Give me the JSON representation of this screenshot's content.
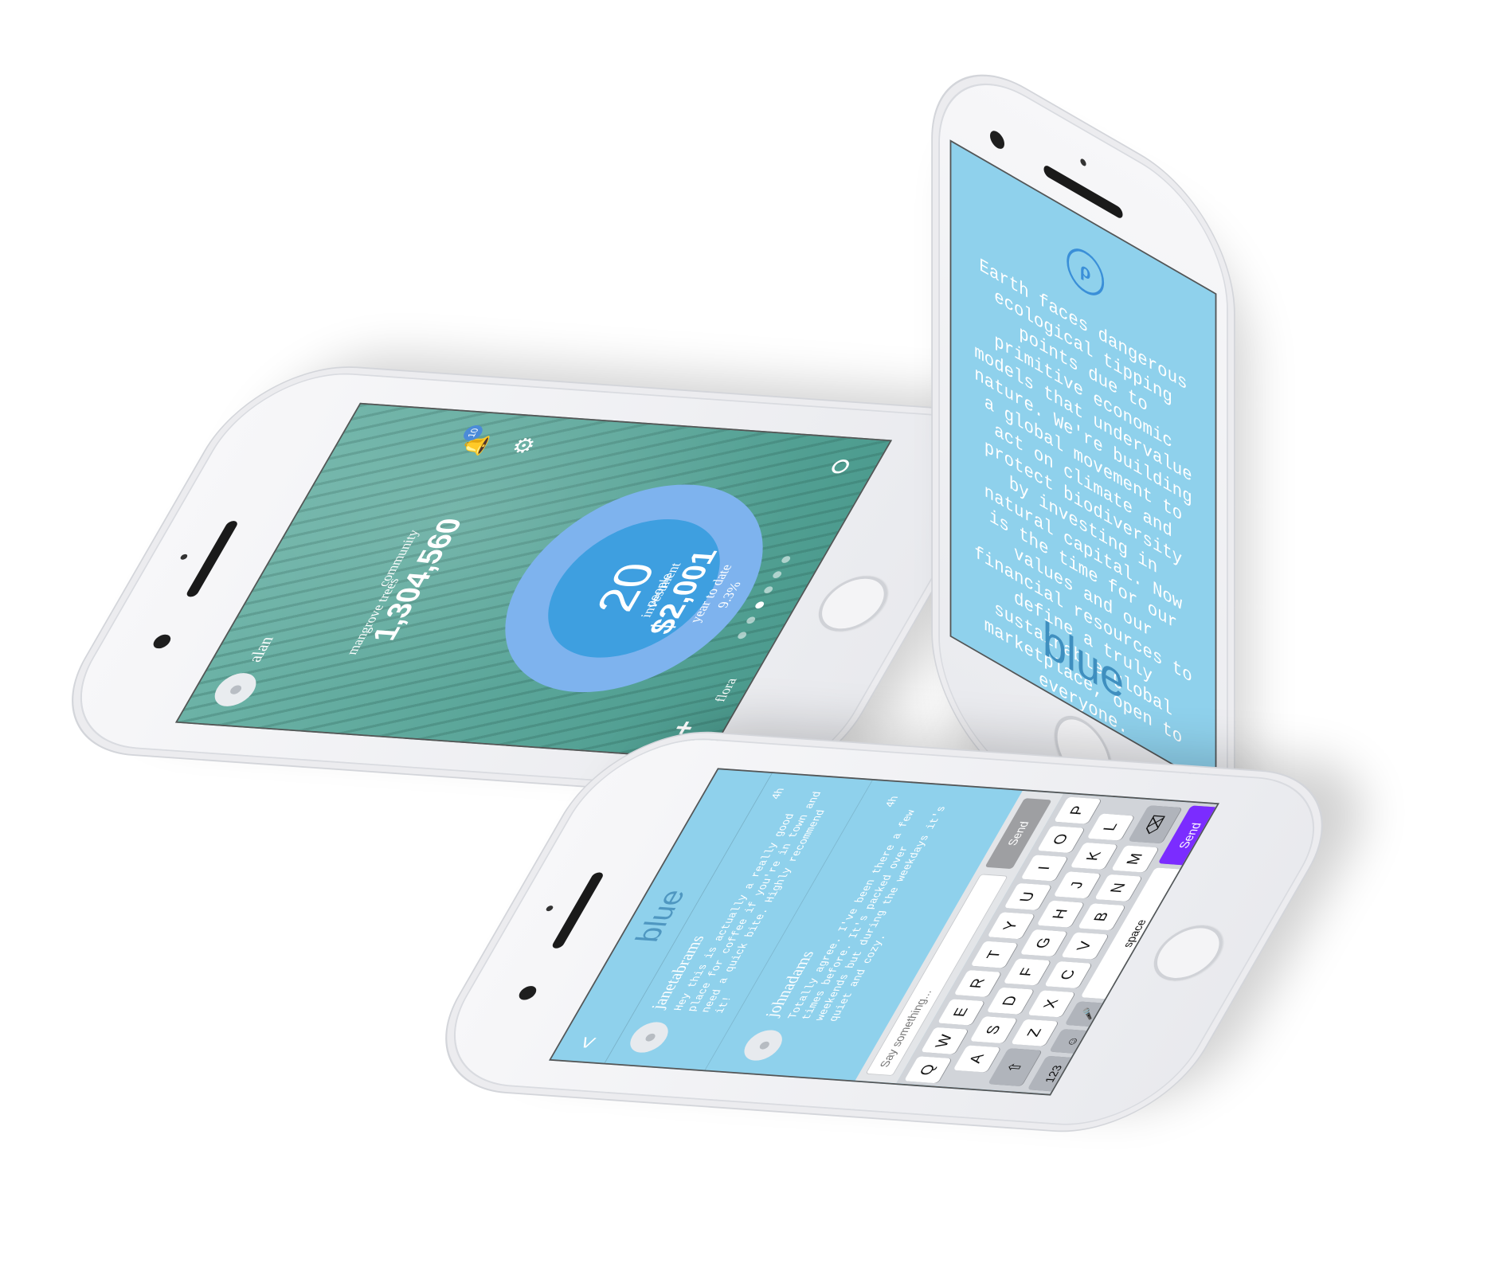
{
  "dashboard": {
    "username": "alan",
    "community_label": "community",
    "community_value": "1,304,560",
    "trees_label": "mangrove trees",
    "notification_count": "10",
    "people_count": "20",
    "people_label": "people",
    "flora_label": "flora",
    "investment_label": "investment",
    "investment_value": "$2,001",
    "ytd_label": "year to date",
    "ytd_percent": "9.3%",
    "plus_label": "+",
    "active_page_index": 2,
    "page_count": 6
  },
  "manifesto": {
    "text": "Earth faces dangerous ecological tipping points due to primitive economic models that undervalue nature. We're building a global movement to act on climate and protect biodiversity by investing in natural capital. Now is the time for our values and our financial resources to define a truly sustainable global marketplace, open to everyone.",
    "brand": "blue"
  },
  "chat": {
    "title": "blue",
    "back_label": "<",
    "messages": [
      {
        "user": "janetabrams",
        "time": "4h",
        "text": "Hey this is actually a really good place for coffee if you're in town and need a quick bite. Highly recommend it!"
      },
      {
        "user": "johnadams",
        "time": "4h",
        "text": "Totally agree. I've been there a few times before. It's packed over weekends but during the weekdays it's quiet and cozy."
      }
    ],
    "input_placeholder": "Say something...",
    "send_label": "Send",
    "keyboard": {
      "row1": [
        "Q",
        "W",
        "E",
        "R",
        "T",
        "Y",
        "U",
        "I",
        "O",
        "P"
      ],
      "row2": [
        "A",
        "S",
        "D",
        "F",
        "G",
        "H",
        "J",
        "K",
        "L"
      ],
      "row3": [
        "Z",
        "X",
        "C",
        "V",
        "B",
        "N",
        "M"
      ],
      "shift_label": "⇧",
      "delete_label": "⌫",
      "numbers_label": "123",
      "emoji_label": "☺",
      "mic_label": "🎤",
      "space_label": "space",
      "send_label": "Send"
    }
  }
}
